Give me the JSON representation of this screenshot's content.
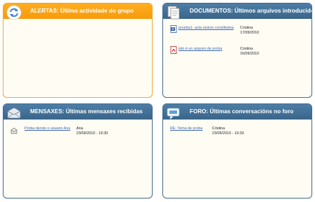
{
  "panels": {
    "alertas": {
      "title": "ALERTAS: Última actividade do grupo",
      "icon": "refresh-icon",
      "color": "#f79a0a"
    },
    "documentos": {
      "title": "DOCUMENTOS: Últimos arquivos introducidos",
      "icon": "documents-icon",
      "color": "#3a6589",
      "items": [
        {
          "icon": "word-doc-icon",
          "link": "prueba1- acta sesion constitutiva",
          "author": "Cristina",
          "date": "17/09/2010"
        },
        {
          "icon": "pdf-icon",
          "link": "isto é un arquivo de proba",
          "author": "Cristina",
          "date": "16/09/2010"
        }
      ]
    },
    "mensaxes": {
      "title": "MENSAXES: Últimas mensaxes recibidas",
      "icon": "envelope-icon",
      "color": "#3a6589",
      "items": [
        {
          "icon": "message-icon",
          "link": "Proba dende o usuario Ana",
          "author": "Ana",
          "date": "23/09/2010 - 19:30"
        }
      ]
    },
    "foro": {
      "title": "FORO: Últimas conversacións no foro",
      "icon": "speech-bubble-icon",
      "color": "#3a6589",
      "items": [
        {
          "link": "RE: Tema de proba",
          "author": "Cristina",
          "date": "23/09/2010 - 19:29"
        }
      ]
    }
  }
}
